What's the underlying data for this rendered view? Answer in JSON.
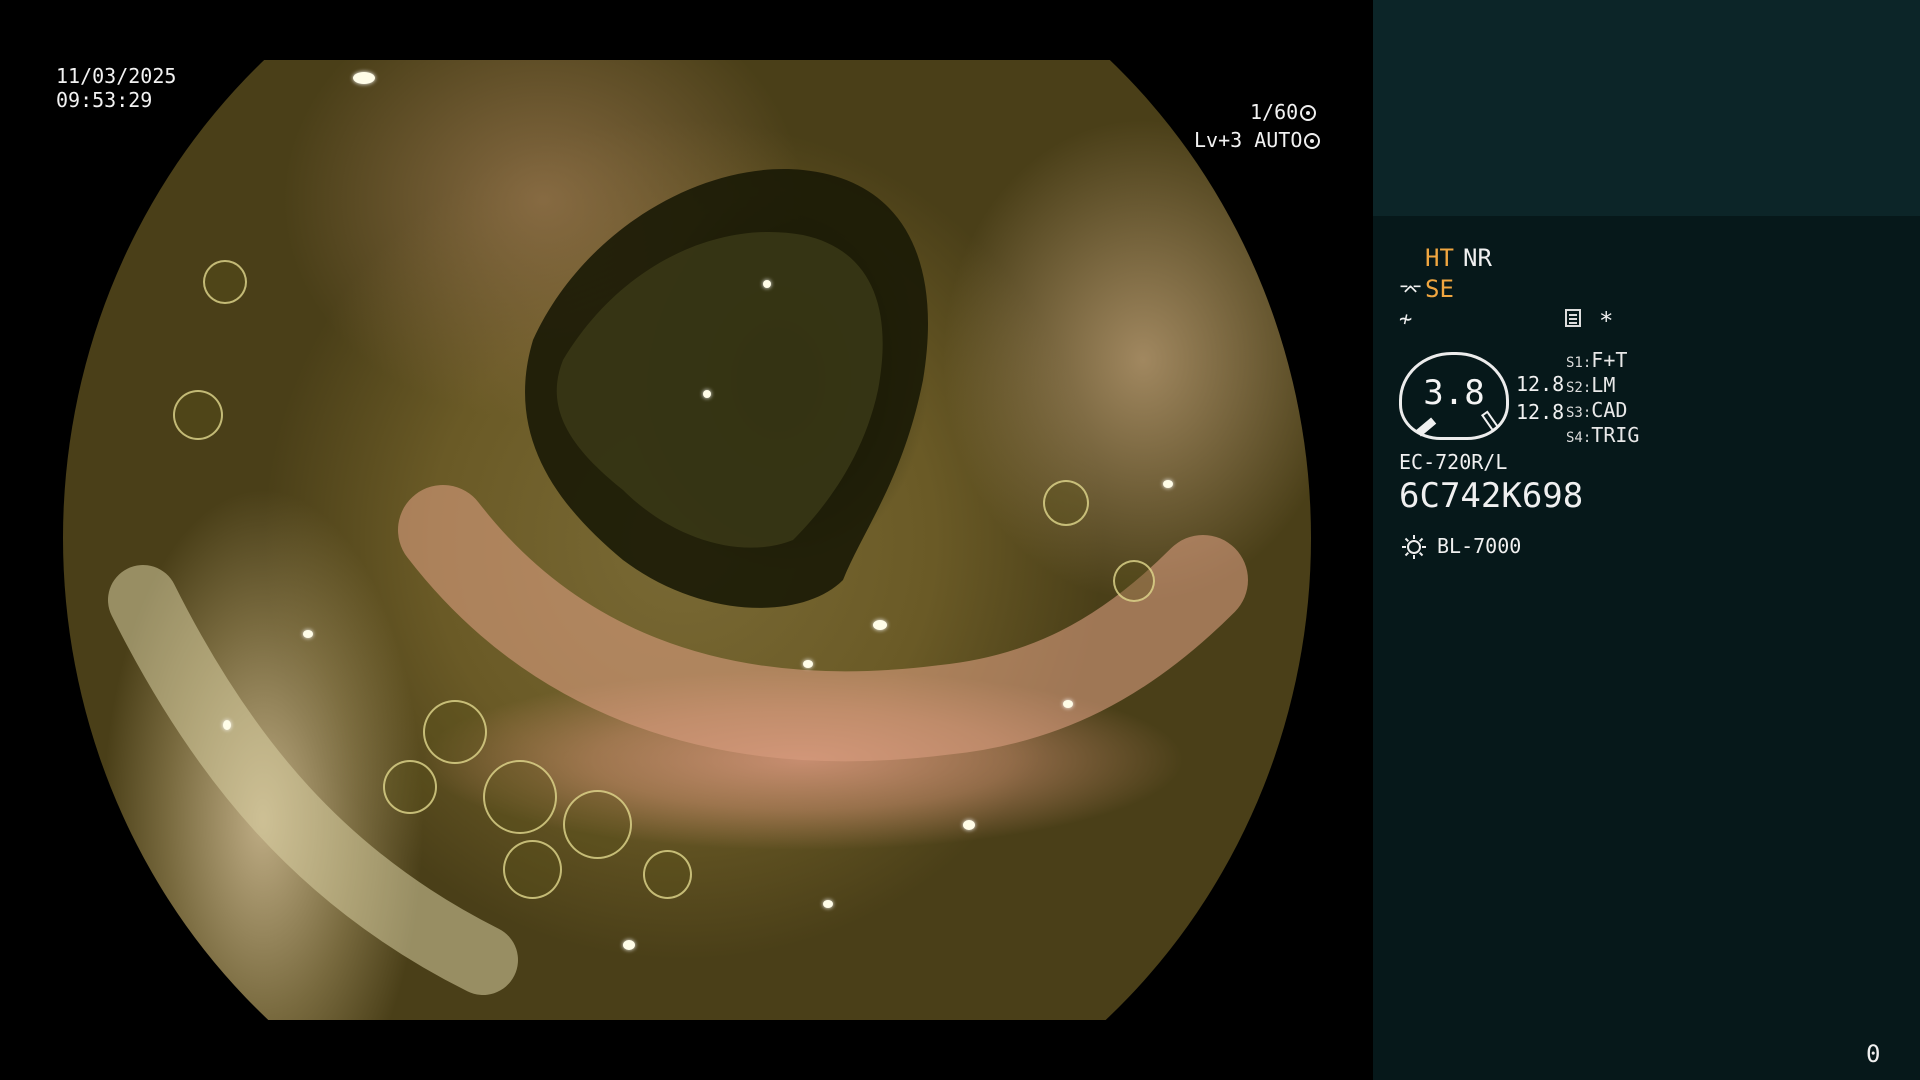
{
  "video": {
    "date": "11/03/2025",
    "time": "09:53:29",
    "shutter": "1/60",
    "shutter_icon": "aperture-icon",
    "level": "Lv+3 AUTO",
    "level_icon": "iris-icon"
  },
  "panel": {
    "modes": {
      "ht": "HT",
      "nr": "NR",
      "se": "SE"
    },
    "icons": {
      "se": "scope-bend-icon",
      "structure": "structure-enhance-icon",
      "doc": "memo-icon"
    },
    "star": "*",
    "dial": {
      "value": "3.8"
    },
    "values": [
      "12.8",
      "12.8"
    ],
    "switches": [
      {
        "key": "S1:",
        "value": "F+T"
      },
      {
        "key": "S2:",
        "value": "LM"
      },
      {
        "key": "S3:",
        "value": "CAD"
      },
      {
        "key": "S4:",
        "value": "TRIG"
      }
    ],
    "scope_model": "EC-720R/L",
    "scope_serial": "6C742K698",
    "light_source": "BL-7000",
    "light_icon": "light-source-icon",
    "counter": "0"
  },
  "colors": {
    "panel_bg": "#06181a",
    "panel_top_bg": "#0c2528",
    "accent_orange": "#f0a640",
    "text": "#f0f0f0"
  }
}
